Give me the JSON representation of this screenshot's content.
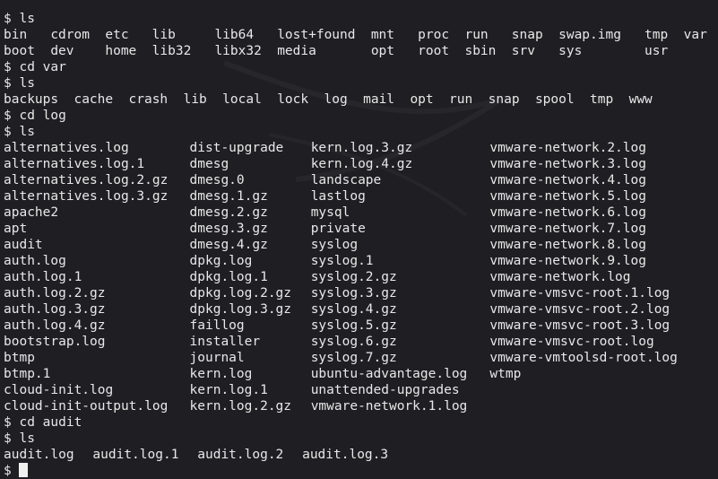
{
  "prompt": "$",
  "commands": {
    "ls1": "ls",
    "cd_var": "cd var",
    "ls2": "ls",
    "cd_log": "cd log",
    "ls3": "ls",
    "cd_audit": "cd audit",
    "ls4": "ls"
  },
  "root_listing": {
    "row1": [
      "bin",
      "cdrom",
      "etc",
      "lib",
      "lib64",
      "lost+found",
      "mnt",
      "proc",
      "run",
      "snap",
      "swap.img",
      "tmp",
      "var"
    ],
    "row2": [
      "boot",
      "dev",
      "home",
      "lib32",
      "libx32",
      "media",
      "",
      "opt",
      "root",
      "sbin",
      "srv",
      "sys",
      "usr"
    ]
  },
  "var_listing": [
    "backups",
    "cache",
    "crash",
    "lib",
    "local",
    "lock",
    "log",
    "mail",
    "opt",
    "run",
    "snap",
    "spool",
    "tmp",
    "www"
  ],
  "log_listing": {
    "col1": [
      "alternatives.log",
      "alternatives.log.1",
      "alternatives.log.2.gz",
      "alternatives.log.3.gz",
      "apache2",
      "apt",
      "audit",
      "auth.log",
      "auth.log.1",
      "auth.log.2.gz",
      "auth.log.3.gz",
      "auth.log.4.gz",
      "bootstrap.log",
      "btmp",
      "btmp.1",
      "cloud-init.log",
      "cloud-init-output.log"
    ],
    "col2": [
      "dist-upgrade",
      "dmesg",
      "dmesg.0",
      "dmesg.1.gz",
      "dmesg.2.gz",
      "dmesg.3.gz",
      "dmesg.4.gz",
      "dpkg.log",
      "dpkg.log.1",
      "dpkg.log.2.gz",
      "dpkg.log.3.gz",
      "faillog",
      "installer",
      "journal",
      "kern.log",
      "kern.log.1",
      "kern.log.2.gz"
    ],
    "col3": [
      "kern.log.3.gz",
      "kern.log.4.gz",
      "landscape",
      "lastlog",
      "mysql",
      "private",
      "syslog",
      "syslog.1",
      "syslog.2.gz",
      "syslog.3.gz",
      "syslog.4.gz",
      "syslog.5.gz",
      "syslog.6.gz",
      "syslog.7.gz",
      "ubuntu-advantage.log",
      "unattended-upgrades",
      "vmware-network.1.log"
    ],
    "col4": [
      "vmware-network.2.log",
      "vmware-network.3.log",
      "vmware-network.4.log",
      "vmware-network.5.log",
      "vmware-network.6.log",
      "vmware-network.7.log",
      "vmware-network.8.log",
      "vmware-network.9.log",
      "vmware-network.log",
      "vmware-vmsvc-root.1.log",
      "vmware-vmsvc-root.2.log",
      "vmware-vmsvc-root.3.log",
      "vmware-vmsvc-root.log",
      "vmware-vmtoolsd-root.log",
      "wtmp",
      "",
      ""
    ]
  },
  "audit_listing": [
    "audit.log",
    "audit.log.1",
    "audit.log.2",
    "audit.log.3"
  ],
  "colors": {
    "background": "#1f1f23",
    "foreground": "#e8e8e8"
  }
}
